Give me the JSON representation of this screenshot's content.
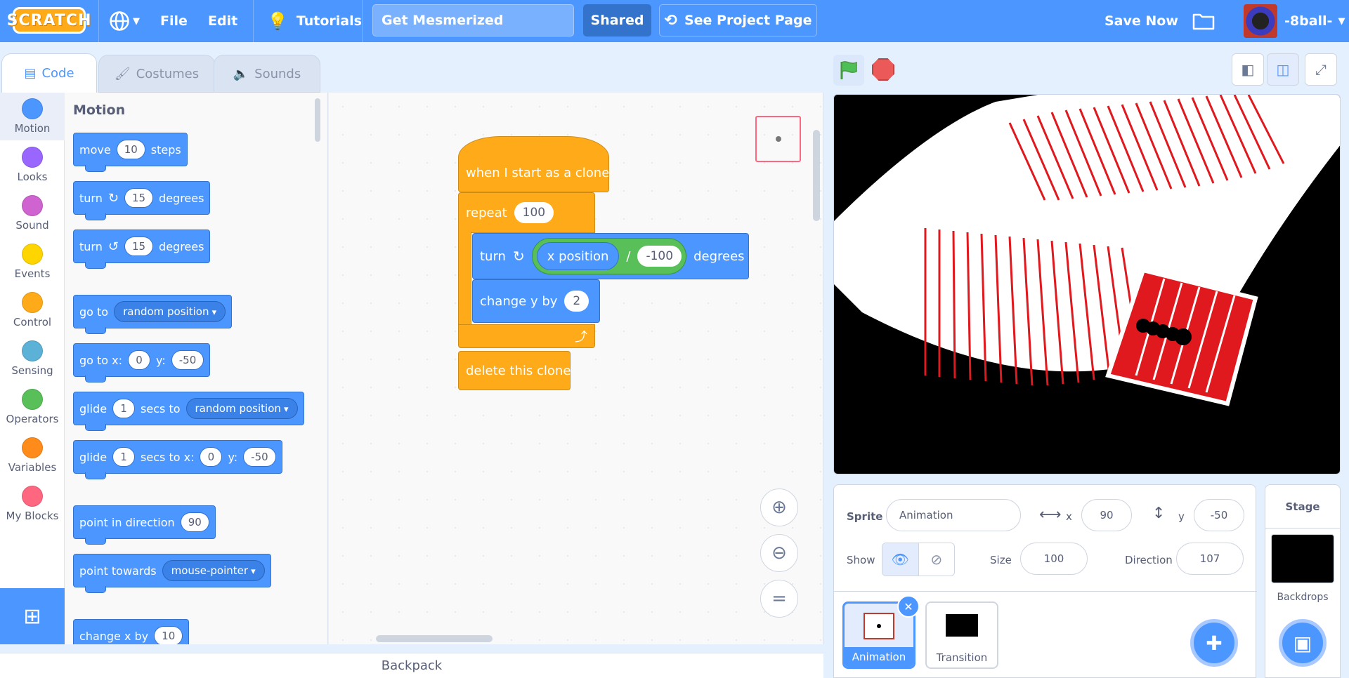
{
  "menubar": {
    "logo": "SCRATCH",
    "file": "File",
    "edit": "Edit",
    "tutorials": "Tutorials",
    "project_title": "Get Mesmerized",
    "shared": "Shared",
    "see_project_page": "See Project Page",
    "save_now": "Save Now",
    "username": "-8ball-"
  },
  "tabs": {
    "code": "Code",
    "costumes": "Costumes",
    "sounds": "Sounds"
  },
  "categories": [
    {
      "label": "Motion",
      "color": "#4c97ff"
    },
    {
      "label": "Looks",
      "color": "#9966ff"
    },
    {
      "label": "Sound",
      "color": "#cf63cf"
    },
    {
      "label": "Events",
      "color": "#ffd500"
    },
    {
      "label": "Control",
      "color": "#ffab19"
    },
    {
      "label": "Sensing",
      "color": "#5cb1d6"
    },
    {
      "label": "Operators",
      "color": "#59c059"
    },
    {
      "label": "Variables",
      "color": "#ff8c1a"
    },
    {
      "label": "My Blocks",
      "color": "#ff6680"
    }
  ],
  "palette": {
    "title": "Motion",
    "move": {
      "a": "move",
      "n": "10",
      "b": "steps"
    },
    "turn_right": {
      "a": "turn",
      "n": "15",
      "b": "degrees"
    },
    "turn_left": {
      "a": "turn",
      "n": "15",
      "b": "degrees"
    },
    "goto": {
      "a": "go to",
      "opt": "random position"
    },
    "gotoxy": {
      "a": "go to x:",
      "x": "0",
      "yl": "y:",
      "y": "-50"
    },
    "glide": {
      "a": "glide",
      "n": "1",
      "b": "secs to",
      "opt": "random position"
    },
    "glidexy": {
      "a": "glide",
      "n": "1",
      "b": "secs to x:",
      "x": "0",
      "yl": "y:",
      "y": "-50"
    },
    "point_dir": {
      "a": "point in direction",
      "n": "90"
    },
    "point_towards": {
      "a": "point towards",
      "opt": "mouse-pointer"
    },
    "change_x": {
      "a": "change x by",
      "n": "10"
    }
  },
  "script": {
    "hat": "when I start as a clone",
    "repeat": "repeat",
    "repeat_n": "100",
    "turn": "turn",
    "xpos": "x position",
    "div": "/",
    "divisor": "-100",
    "degrees": "degrees",
    "change_y": "change y by",
    "change_y_n": "2",
    "delete": "delete this clone"
  },
  "backpack": "Backpack",
  "sprite": {
    "label": "Sprite",
    "name": "Animation",
    "x_label": "x",
    "x": "90",
    "y_label": "y",
    "y": "-50",
    "show": "Show",
    "size_label": "Size",
    "size": "100",
    "direction_label": "Direction",
    "direction": "107"
  },
  "sprites": [
    {
      "name": "Animation"
    },
    {
      "name": "Transition"
    }
  ],
  "stage_panel": {
    "title": "Stage",
    "backdrops": "Backdrops"
  }
}
